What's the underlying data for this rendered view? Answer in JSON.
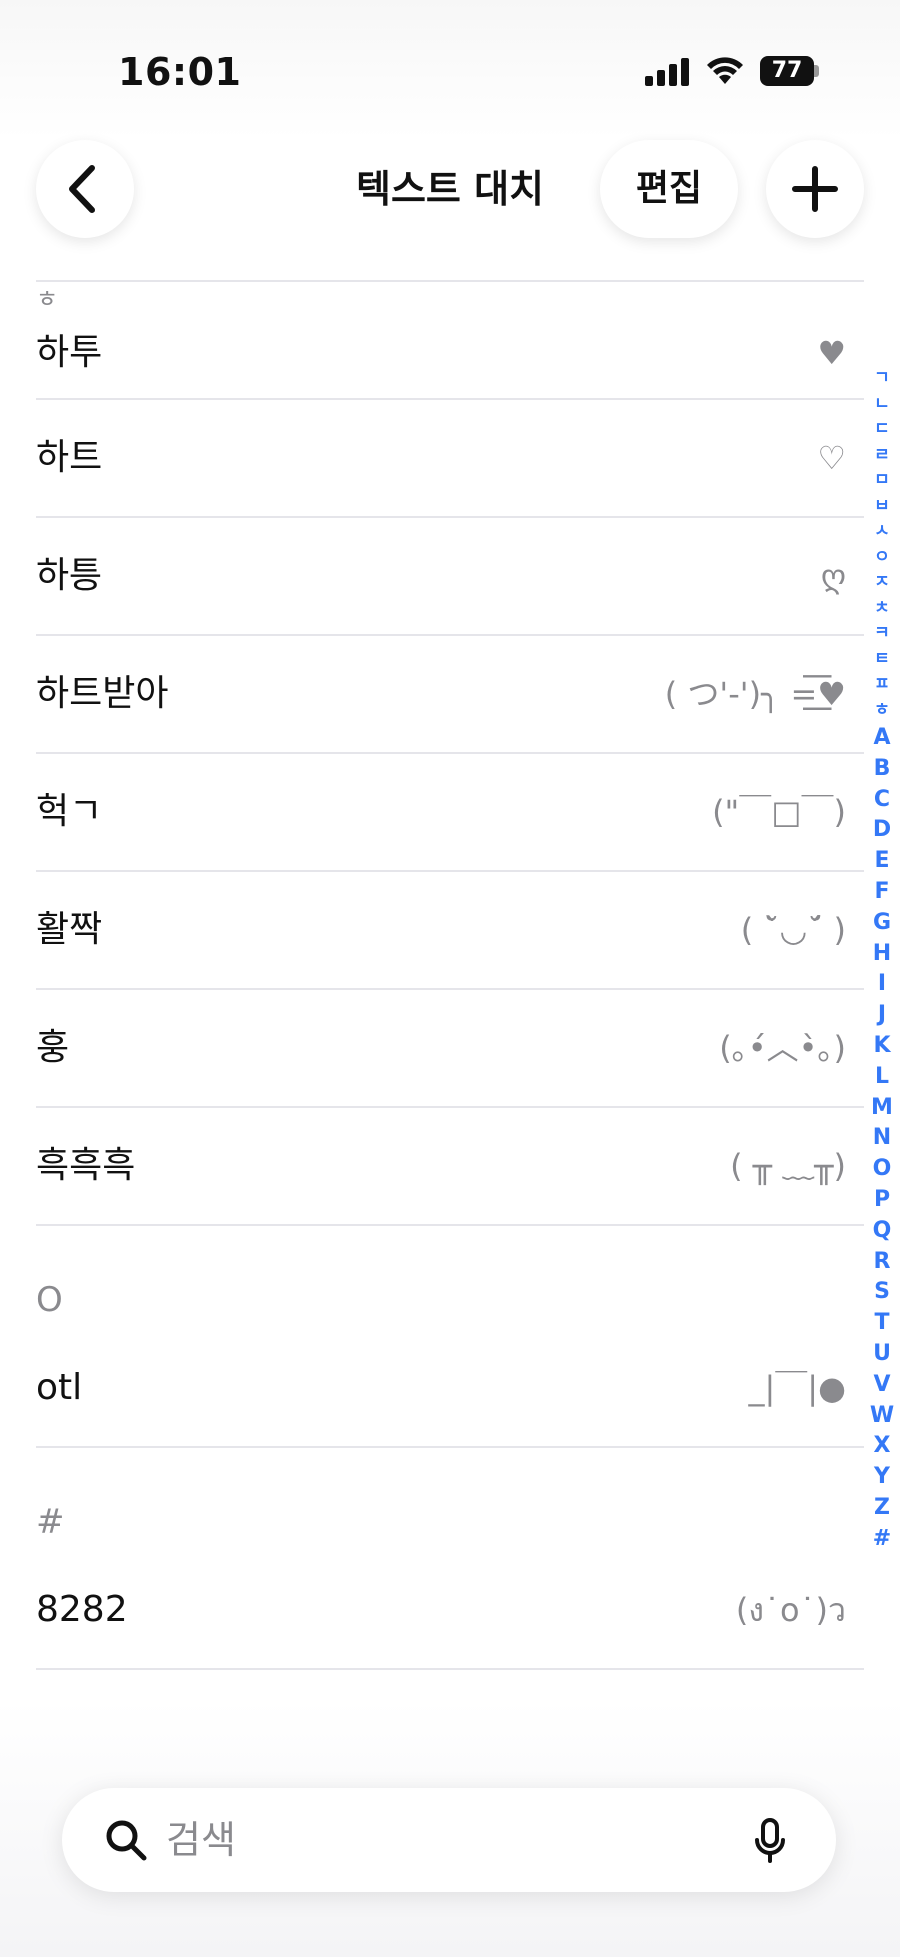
{
  "status": {
    "time": "16:01",
    "battery": "77"
  },
  "nav": {
    "title": "텍스트 대치",
    "edit_label": "편집"
  },
  "sections": [
    {
      "header": "ㅎ",
      "rows": [
        {
          "phrase": "하투",
          "shortcut": "♥"
        },
        {
          "phrase": "하트",
          "shortcut": "♡"
        },
        {
          "phrase": "하틍",
          "shortcut": "ღ"
        },
        {
          "phrase": "하트받아",
          "shortcut": "( つ'-')╮ =͟͟͞♥"
        },
        {
          "phrase": "헉ㄱ",
          "shortcut": "(\"￣□￣)"
        },
        {
          "phrase": "활짝",
          "shortcut": "( ˘̀◡˘́ )"
        },
        {
          "phrase": "훙",
          "shortcut": "(｡•́︿•̀｡)"
        },
        {
          "phrase": "흑흑흑",
          "shortcut": "( ╥ ﹏╥)"
        }
      ]
    },
    {
      "header": "O",
      "rows": [
        {
          "phrase": "otl",
          "shortcut": "_|￣|●"
        }
      ]
    },
    {
      "header": "#",
      "rows": [
        {
          "phrase": "8282",
          "shortcut": "(ง˙o˙)ว"
        }
      ]
    }
  ],
  "index_ko": [
    "ㄱ",
    "ㄴ",
    "ㄷ",
    "ㄹ",
    "ㅁ",
    "ㅂ",
    "ㅅ",
    "ㅇ",
    "ㅈ",
    "ㅊ",
    "ㅋ",
    "ㅌ",
    "ㅍ",
    "ㅎ"
  ],
  "index_en": [
    "A",
    "B",
    "C",
    "D",
    "E",
    "F",
    "G",
    "H",
    "I",
    "J",
    "K",
    "L",
    "M",
    "N",
    "O",
    "P",
    "Q",
    "R",
    "S",
    "T",
    "U",
    "V",
    "W",
    "X",
    "Y",
    "Z",
    "#"
  ],
  "search": {
    "placeholder": "검색"
  },
  "icons": {
    "back": "chevron-left-icon",
    "add": "plus-icon",
    "search": "search-icon",
    "mic": "microphone-icon"
  }
}
